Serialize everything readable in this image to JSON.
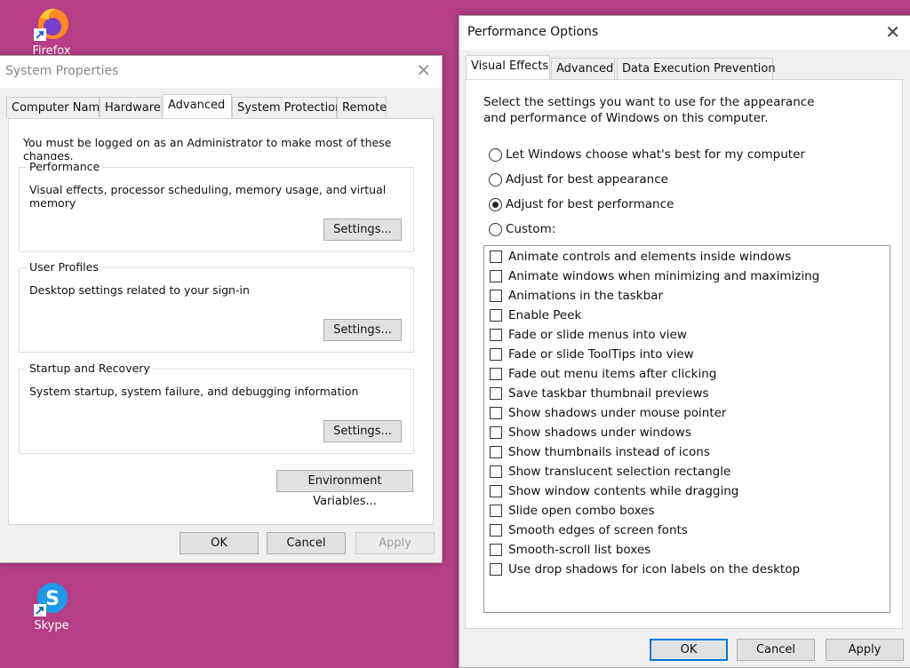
{
  "desktop": {
    "icons": [
      {
        "label": "Firefox",
        "icon": "firefox-icon"
      },
      {
        "label": "Skype",
        "icon": "skype-icon"
      }
    ],
    "background": "#b63e86"
  },
  "system_properties": {
    "title": "System Properties",
    "tabs": [
      "Computer Name",
      "Hardware",
      "Advanced",
      "System Protection",
      "Remote"
    ],
    "active_tab": "Advanced",
    "admin_note": "You must be logged on as an Administrator to make most of these changes.",
    "groups": [
      {
        "title": "Performance",
        "desc": "Visual effects, processor scheduling, memory usage, and virtual memory",
        "button": "Settings..."
      },
      {
        "title": "User Profiles",
        "desc": "Desktop settings related to your sign-in",
        "button": "Settings..."
      },
      {
        "title": "Startup and Recovery",
        "desc": "System startup, system failure, and debugging information",
        "button": "Settings..."
      }
    ],
    "env_button": "Environment Variables...",
    "ok": "OK",
    "cancel": "Cancel",
    "apply": "Apply"
  },
  "performance_options": {
    "title": "Performance Options",
    "tabs": [
      "Visual Effects",
      "Advanced",
      "Data Execution Prevention"
    ],
    "active_tab": "Visual Effects",
    "intro": "Select the settings you want to use for the appearance and performance of Windows on this computer.",
    "radios": [
      {
        "label": "Let Windows choose what's best for my computer",
        "checked": false
      },
      {
        "label": "Adjust for best appearance",
        "checked": false
      },
      {
        "label": "Adjust for best performance",
        "checked": true
      },
      {
        "label": "Custom:",
        "checked": false
      }
    ],
    "checkboxes": [
      {
        "label": "Animate controls and elements inside windows",
        "checked": false
      },
      {
        "label": "Animate windows when minimizing and maximizing",
        "checked": false
      },
      {
        "label": "Animations in the taskbar",
        "checked": false
      },
      {
        "label": "Enable Peek",
        "checked": false
      },
      {
        "label": "Fade or slide menus into view",
        "checked": false
      },
      {
        "label": "Fade or slide ToolTips into view",
        "checked": false
      },
      {
        "label": "Fade out menu items after clicking",
        "checked": false
      },
      {
        "label": "Save taskbar thumbnail previews",
        "checked": false
      },
      {
        "label": "Show shadows under mouse pointer",
        "checked": false
      },
      {
        "label": "Show shadows under windows",
        "checked": false
      },
      {
        "label": "Show thumbnails instead of icons",
        "checked": false
      },
      {
        "label": "Show translucent selection rectangle",
        "checked": false
      },
      {
        "label": "Show window contents while dragging",
        "checked": false
      },
      {
        "label": "Slide open combo boxes",
        "checked": false
      },
      {
        "label": "Smooth edges of screen fonts",
        "checked": false
      },
      {
        "label": "Smooth-scroll list boxes",
        "checked": false
      },
      {
        "label": "Use drop shadows for icon labels on the desktop",
        "checked": false
      }
    ],
    "ok": "OK",
    "cancel": "Cancel",
    "apply": "Apply"
  }
}
